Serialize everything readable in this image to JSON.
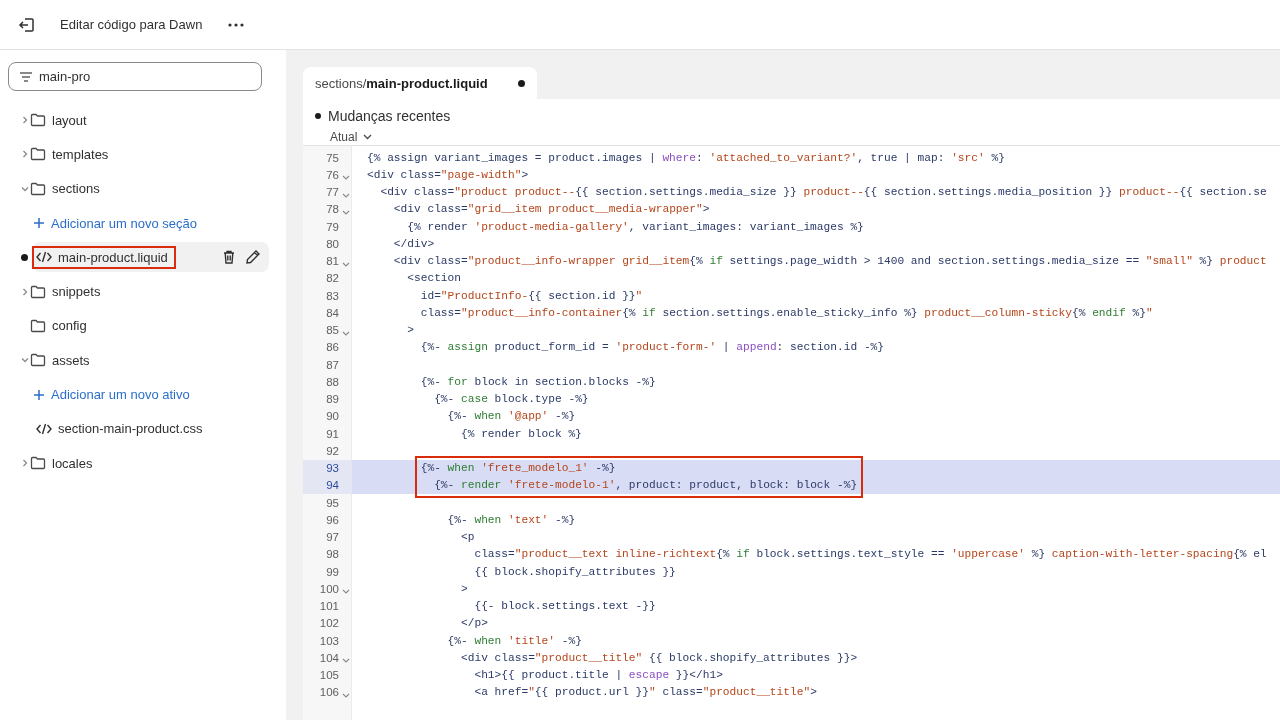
{
  "top_bar": {
    "title": "Editar código para Dawn"
  },
  "sidebar": {
    "search": {
      "value": "main-pro"
    },
    "items": [
      {
        "kind": "folder",
        "label": "layout",
        "expanded": false
      },
      {
        "kind": "folder",
        "label": "templates",
        "expanded": false
      },
      {
        "kind": "folder",
        "label": "sections",
        "expanded": true,
        "children": [
          {
            "kind": "add",
            "label": "Adicionar um novo seção"
          },
          {
            "kind": "file",
            "label": "main-product.liquid",
            "selected": true,
            "modified": true,
            "boxed": true
          }
        ]
      },
      {
        "kind": "folder",
        "label": "snippets",
        "expanded": false
      },
      {
        "kind": "directory",
        "label": "config"
      },
      {
        "kind": "folder",
        "label": "assets",
        "expanded": true,
        "children": [
          {
            "kind": "add",
            "label": "Adicionar um novo ativo"
          },
          {
            "kind": "file",
            "label": "section-main-product.css",
            "selected": false,
            "modified": false,
            "boxed": false
          }
        ]
      },
      {
        "kind": "folder",
        "label": "locales",
        "expanded": false
      }
    ]
  },
  "editor": {
    "tab": {
      "label": "sections/**main-product.liquid**",
      "unsaved": true,
      "selected": true
    },
    "recent_changes": {
      "title": "Mudanças recentes",
      "version": "Atual"
    },
    "lines": [
      {
        "number": "75",
        "foldable": false,
        "selected": false,
        "boxed": false,
        "tokens": [
          {
            "text": "{% assign variant_images = product.images | ",
            "kind": "plain"
          },
          {
            "text": "where",
            "kind": "filter"
          },
          {
            "text": ": ",
            "kind": "plain"
          },
          {
            "text": "'attached_to_variant?'",
            "kind": "string"
          },
          {
            "text": ", true | map: ",
            "kind": "plain"
          },
          {
            "text": "'src'",
            "kind": "string"
          },
          {
            "text": " %}",
            "kind": "plain"
          }
        ]
      },
      {
        "number": "76",
        "foldable": true,
        "selected": false,
        "boxed": false,
        "tokens": [
          {
            "text": "<div class=",
            "kind": "plain"
          },
          {
            "text": "\"page-width\"",
            "kind": "string"
          },
          {
            "text": ">",
            "kind": "plain"
          }
        ]
      },
      {
        "number": "77",
        "foldable": true,
        "selected": false,
        "boxed": false,
        "tokens": [
          {
            "text": "  <div class=",
            "kind": "plain"
          },
          {
            "text": "\"product product--",
            "kind": "string"
          },
          {
            "text": "{{ section.settings.media_size }}",
            "kind": "plain"
          },
          {
            "text": " product--",
            "kind": "string"
          },
          {
            "text": "{{ section.settings.media_position }}",
            "kind": "plain"
          },
          {
            "text": " product--",
            "kind": "string"
          },
          {
            "text": "{{ section.se",
            "kind": "plain"
          }
        ]
      },
      {
        "number": "78",
        "foldable": true,
        "selected": false,
        "boxed": false,
        "tokens": [
          {
            "text": "    <div class=",
            "kind": "plain"
          },
          {
            "text": "\"grid__item product__media-wrapper\"",
            "kind": "string"
          },
          {
            "text": ">",
            "kind": "plain"
          }
        ]
      },
      {
        "number": "79",
        "foldable": false,
        "selected": false,
        "boxed": false,
        "tokens": [
          {
            "text": "      {% render ",
            "kind": "plain"
          },
          {
            "text": "'product-media-gallery'",
            "kind": "string"
          },
          {
            "text": ", variant_images: variant_images %}",
            "kind": "plain"
          }
        ]
      },
      {
        "number": "80",
        "foldable": false,
        "selected": false,
        "boxed": false,
        "tokens": [
          {
            "text": "    </div>",
            "kind": "plain"
          }
        ]
      },
      {
        "number": "81",
        "foldable": true,
        "selected": false,
        "boxed": false,
        "tokens": [
          {
            "text": "    <div class=",
            "kind": "plain"
          },
          {
            "text": "\"product__info-wrapper grid__item",
            "kind": "string"
          },
          {
            "text": "{% ",
            "kind": "plain"
          },
          {
            "text": "if",
            "kind": "keyword"
          },
          {
            "text": " settings.page_width > 1400 and section.settings.media_size == ",
            "kind": "plain"
          },
          {
            "text": "\"small\"",
            "kind": "string"
          },
          {
            "text": " %}",
            "kind": "plain"
          },
          {
            "text": " product",
            "kind": "string"
          }
        ]
      },
      {
        "number": "82",
        "foldable": false,
        "selected": false,
        "boxed": false,
        "tokens": [
          {
            "text": "      <section",
            "kind": "plain"
          }
        ]
      },
      {
        "number": "83",
        "foldable": false,
        "selected": false,
        "boxed": false,
        "tokens": [
          {
            "text": "        id=",
            "kind": "plain"
          },
          {
            "text": "\"ProductInfo-",
            "kind": "string"
          },
          {
            "text": "{{ section.id }}",
            "kind": "plain"
          },
          {
            "text": "\"",
            "kind": "string"
          }
        ]
      },
      {
        "number": "84",
        "foldable": false,
        "selected": false,
        "boxed": false,
        "tokens": [
          {
            "text": "        class=",
            "kind": "plain"
          },
          {
            "text": "\"product__info-container",
            "kind": "string"
          },
          {
            "text": "{% ",
            "kind": "plain"
          },
          {
            "text": "if",
            "kind": "keyword"
          },
          {
            "text": " section.settings.enable_sticky_info %}",
            "kind": "plain"
          },
          {
            "text": " product__column-sticky",
            "kind": "string"
          },
          {
            "text": "{% ",
            "kind": "plain"
          },
          {
            "text": "endif",
            "kind": "keyword"
          },
          {
            "text": " %}",
            "kind": "plain"
          },
          {
            "text": "\"",
            "kind": "string"
          }
        ]
      },
      {
        "number": "85",
        "foldable": true,
        "selected": false,
        "boxed": false,
        "tokens": [
          {
            "text": "      >",
            "kind": "plain"
          }
        ]
      },
      {
        "number": "86",
        "foldable": false,
        "selected": false,
        "boxed": false,
        "tokens": [
          {
            "text": "        {%- ",
            "kind": "plain"
          },
          {
            "text": "assign",
            "kind": "keyword"
          },
          {
            "text": " product_form_id = ",
            "kind": "plain"
          },
          {
            "text": "'product-form-'",
            "kind": "string"
          },
          {
            "text": " | ",
            "kind": "plain"
          },
          {
            "text": "append",
            "kind": "filter"
          },
          {
            "text": ": section.id -%}",
            "kind": "plain"
          }
        ]
      },
      {
        "number": "87",
        "foldable": false,
        "selected": false,
        "boxed": false
      },
      {
        "number": "88",
        "foldable": false,
        "selected": false,
        "boxed": false,
        "tokens": [
          {
            "text": "        {%- ",
            "kind": "plain"
          },
          {
            "text": "for",
            "kind": "keyword"
          },
          {
            "text": " block in section.blocks -%}",
            "kind": "plain"
          }
        ]
      },
      {
        "number": "89",
        "foldable": false,
        "selected": false,
        "boxed": false,
        "tokens": [
          {
            "text": "          {%- ",
            "kind": "plain"
          },
          {
            "text": "case",
            "kind": "keyword"
          },
          {
            "text": " block.type -%}",
            "kind": "plain"
          }
        ]
      },
      {
        "number": "90",
        "foldable": false,
        "selected": false,
        "boxed": false,
        "tokens": [
          {
            "text": "            {%- ",
            "kind": "plain"
          },
          {
            "text": "when",
            "kind": "keyword"
          },
          {
            "text": " '@app'",
            "kind": "string"
          },
          {
            "text": " -%}",
            "kind": "plain"
          }
        ]
      },
      {
        "number": "91",
        "foldable": false,
        "selected": false,
        "boxed": false,
        "tokens": [
          {
            "text": "              {% render block %}",
            "kind": "plain"
          }
        ]
      },
      {
        "number": "92",
        "foldable": false,
        "selected": false,
        "boxed": false
      },
      {
        "number": "93",
        "foldable": false,
        "selected": true,
        "boxed": true,
        "tokens": [
          {
            "text": "        {%- ",
            "kind": "plain"
          },
          {
            "text": "when",
            "kind": "keyword"
          },
          {
            "text": " 'frete_modelo_1'",
            "kind": "string"
          },
          {
            "text": " -%}",
            "kind": "plain"
          }
        ]
      },
      {
        "number": "94",
        "foldable": false,
        "selected": true,
        "boxed": true,
        "tokens": [
          {
            "text": "          {%- ",
            "kind": "plain"
          },
          {
            "text": "render",
            "kind": "keyword"
          },
          {
            "text": " 'frete-modelo-1'",
            "kind": "string"
          },
          {
            "text": ", product: product, block: block -%}",
            "kind": "plain"
          }
        ]
      },
      {
        "number": "95",
        "foldable": false,
        "selected": false,
        "boxed": false
      },
      {
        "number": "96",
        "foldable": false,
        "selected": false,
        "boxed": false,
        "tokens": [
          {
            "text": "            {%- ",
            "kind": "plain"
          },
          {
            "text": "when",
            "kind": "keyword"
          },
          {
            "text": " 'text'",
            "kind": "string"
          },
          {
            "text": " -%}",
            "kind": "plain"
          }
        ]
      },
      {
        "number": "97",
        "foldable": false,
        "selected": false,
        "boxed": false,
        "tokens": [
          {
            "text": "              <p",
            "kind": "plain"
          }
        ]
      },
      {
        "number": "98",
        "foldable": false,
        "selected": false,
        "boxed": false,
        "tokens": [
          {
            "text": "                class=",
            "kind": "plain"
          },
          {
            "text": "\"product__text inline-richtext",
            "kind": "string"
          },
          {
            "text": "{% ",
            "kind": "plain"
          },
          {
            "text": "if",
            "kind": "keyword"
          },
          {
            "text": " block.settings.text_style == ",
            "kind": "plain"
          },
          {
            "text": "'uppercase'",
            "kind": "string"
          },
          {
            "text": " %}",
            "kind": "plain"
          },
          {
            "text": " caption-with-letter-spacing",
            "kind": "string"
          },
          {
            "text": "{% el",
            "kind": "plain"
          }
        ]
      },
      {
        "number": "99",
        "foldable": false,
        "selected": false,
        "boxed": false,
        "tokens": [
          {
            "text": "                {{ block.shopify_attributes }}",
            "kind": "plain"
          }
        ]
      },
      {
        "number": "100",
        "foldable": true,
        "selected": false,
        "boxed": false,
        "tokens": [
          {
            "text": "              >",
            "kind": "plain"
          }
        ]
      },
      {
        "number": "101",
        "foldable": false,
        "selected": false,
        "boxed": false,
        "tokens": [
          {
            "text": "                {{- block.settings.text -}}",
            "kind": "plain"
          }
        ]
      },
      {
        "number": "102",
        "foldable": false,
        "selected": false,
        "boxed": false,
        "tokens": [
          {
            "text": "              </p>",
            "kind": "plain"
          }
        ]
      },
      {
        "number": "103",
        "foldable": false,
        "selected": false,
        "boxed": false,
        "tokens": [
          {
            "text": "            {%- ",
            "kind": "plain"
          },
          {
            "text": "when",
            "kind": "keyword"
          },
          {
            "text": " 'title'",
            "kind": "string"
          },
          {
            "text": " -%}",
            "kind": "plain"
          }
        ]
      },
      {
        "number": "104",
        "foldable": true,
        "selected": false,
        "boxed": false,
        "tokens": [
          {
            "text": "              <div class=",
            "kind": "plain"
          },
          {
            "text": "\"product__title\"",
            "kind": "string"
          },
          {
            "text": " {{ block.shopify_attributes }}>",
            "kind": "plain"
          }
        ]
      },
      {
        "number": "105",
        "foldable": false,
        "selected": false,
        "boxed": false,
        "tokens": [
          {
            "text": "                <h1>{{ product.title | ",
            "kind": "plain"
          },
          {
            "text": "escape",
            "kind": "filter"
          },
          {
            "text": " }}</h1>",
            "kind": "plain"
          }
        ]
      },
      {
        "number": "106",
        "foldable": true,
        "selected": false,
        "boxed": false,
        "tokens": [
          {
            "text": "                <a href=",
            "kind": "plain"
          },
          {
            "text": "\"",
            "kind": "string"
          },
          {
            "text": "{{ product.url }}",
            "kind": "plain"
          },
          {
            "text": "\"",
            "kind": "string"
          },
          {
            "text": " class=",
            "kind": "plain"
          },
          {
            "text": "\"product__title\"",
            "kind": "string"
          },
          {
            "text": ">",
            "kind": "plain"
          }
        ]
      }
    ]
  }
}
